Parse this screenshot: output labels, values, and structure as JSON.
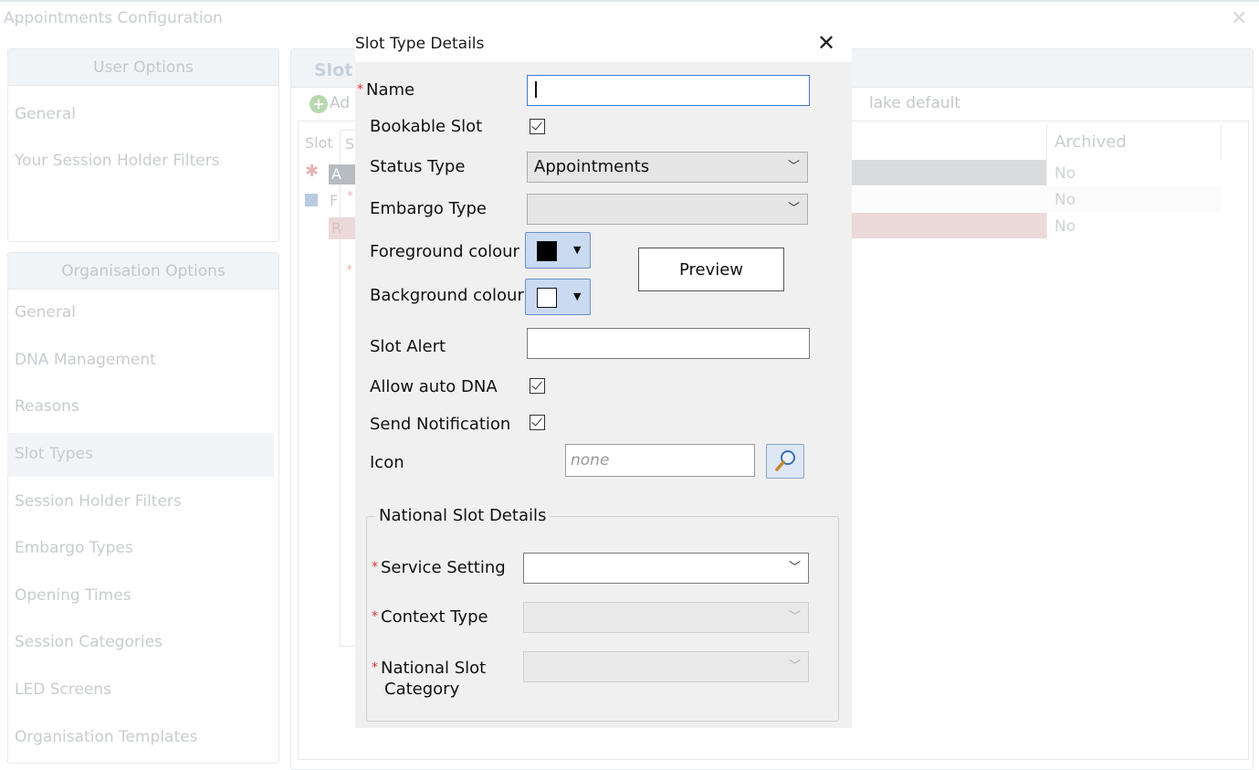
{
  "window": {
    "title": "Appointments Configuration",
    "close_icon": "close-icon"
  },
  "user_options": {
    "header": "User Options",
    "items": [
      "General",
      "Your Session Holder Filters"
    ]
  },
  "org_options": {
    "header": "Organisation Options",
    "items": [
      "General",
      "DNA Management",
      "Reasons",
      "Slot Types",
      "Session Holder Filters",
      "Embargo Types",
      "Opening Times",
      "Session Categories",
      "LED Screens",
      "Organisation Templates"
    ],
    "selected": "Slot Types"
  },
  "main_panel": {
    "header_fragment": "Slot",
    "toolbar_add_fragment": "Ad",
    "toolbar_make_default_fragment": "lake default",
    "grid_label_fragment": "Slot",
    "grid_filter_fragment": "S",
    "tree_item_a": "A",
    "tree_item_f": "F",
    "tree_item_r": "R",
    "archived_header": "Archived",
    "archived_values": [
      "No",
      "No",
      "No"
    ]
  },
  "dialog": {
    "title": "Slot Type Details",
    "name_label": "Name",
    "name_value": "",
    "bookable_label": "Bookable Slot",
    "bookable_checked": true,
    "status_type_label": "Status Type",
    "status_type_value": "Appointments",
    "embargo_type_label": "Embargo Type",
    "embargo_type_value": "",
    "foreground_label": "Foreground colour",
    "foreground_color": "#000000",
    "background_label": "Background colour",
    "background_color": "#ffffff",
    "preview_label": "Preview",
    "slot_alert_label": "Slot Alert",
    "slot_alert_value": "",
    "auto_dna_label": "Allow auto DNA",
    "auto_dna_checked": true,
    "send_notification_label": "Send Notification",
    "send_notification_checked": true,
    "icon_label": "Icon",
    "icon_placeholder": "none",
    "national": {
      "legend": "National Slot Details",
      "service_setting_label": "Service Setting",
      "service_setting_value": "",
      "context_type_label": "Context Type",
      "context_type_value": "",
      "slot_category_label_line1": "National Slot",
      "slot_category_label_line2": "Category",
      "slot_category_value": ""
    }
  },
  "colors": {
    "accent_focus": "#3b78d8",
    "required_star": "#e0342c",
    "row1_bg": "#d9dbde",
    "row3_bg": "#ecd9d9"
  }
}
